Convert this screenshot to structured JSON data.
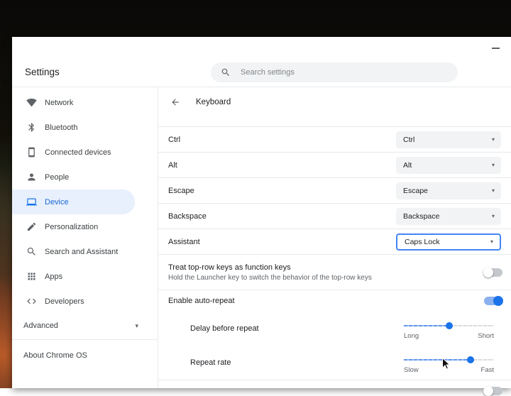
{
  "window": {
    "app_title": "Settings"
  },
  "search": {
    "placeholder": "Search settings"
  },
  "sidebar": {
    "items": [
      {
        "label": "Network",
        "icon": "wifi-icon"
      },
      {
        "label": "Bluetooth",
        "icon": "bluetooth-icon"
      },
      {
        "label": "Connected devices",
        "icon": "smartphone-icon"
      },
      {
        "label": "People",
        "icon": "person-icon"
      },
      {
        "label": "Device",
        "icon": "laptop-icon",
        "active": true
      },
      {
        "label": "Personalization",
        "icon": "pencil-icon"
      },
      {
        "label": "Search and Assistant",
        "icon": "search-icon"
      },
      {
        "label": "Apps",
        "icon": "apps-grid-icon"
      },
      {
        "label": "Developers",
        "icon": "code-icon"
      }
    ],
    "advanced": {
      "label": "Advanced",
      "icon": "chevron-down-icon"
    },
    "about": {
      "label": "About Chrome OS"
    }
  },
  "main": {
    "page_title": "Keyboard",
    "key_remap_rows": [
      {
        "label": "Ctrl",
        "value": "Ctrl",
        "state": "normal"
      },
      {
        "label": "Alt",
        "value": "Alt",
        "state": "normal"
      },
      {
        "label": "Escape",
        "value": "Escape",
        "state": "normal"
      },
      {
        "label": "Backspace",
        "value": "Backspace",
        "state": "normal"
      },
      {
        "label": "Assistant",
        "value": "Caps Lock",
        "state": "focused"
      }
    ],
    "function_keys_row": {
      "label": "Treat top-row keys as function keys",
      "sublabel": "Hold the Launcher key to switch the behavior of the top-row keys",
      "state": "off"
    },
    "auto_repeat_row": {
      "label": "Enable auto-repeat",
      "state": "on"
    },
    "sliders": [
      {
        "label": "Delay before repeat",
        "min_label": "Long",
        "max_label": "Short",
        "percent": 50
      },
      {
        "label": "Repeat rate",
        "min_label": "Slow",
        "max_label": "Fast",
        "percent": 74
      }
    ]
  },
  "colors": {
    "accent": "#1a73e8",
    "active_item_bg": "#e8f0fe",
    "focused_dropdown_border": "#4285f4",
    "toggle_on_track": "#8ab0ee",
    "toggle_off_track": "#c4c7cb",
    "dropdown_bg": "#f1f3f4"
  }
}
